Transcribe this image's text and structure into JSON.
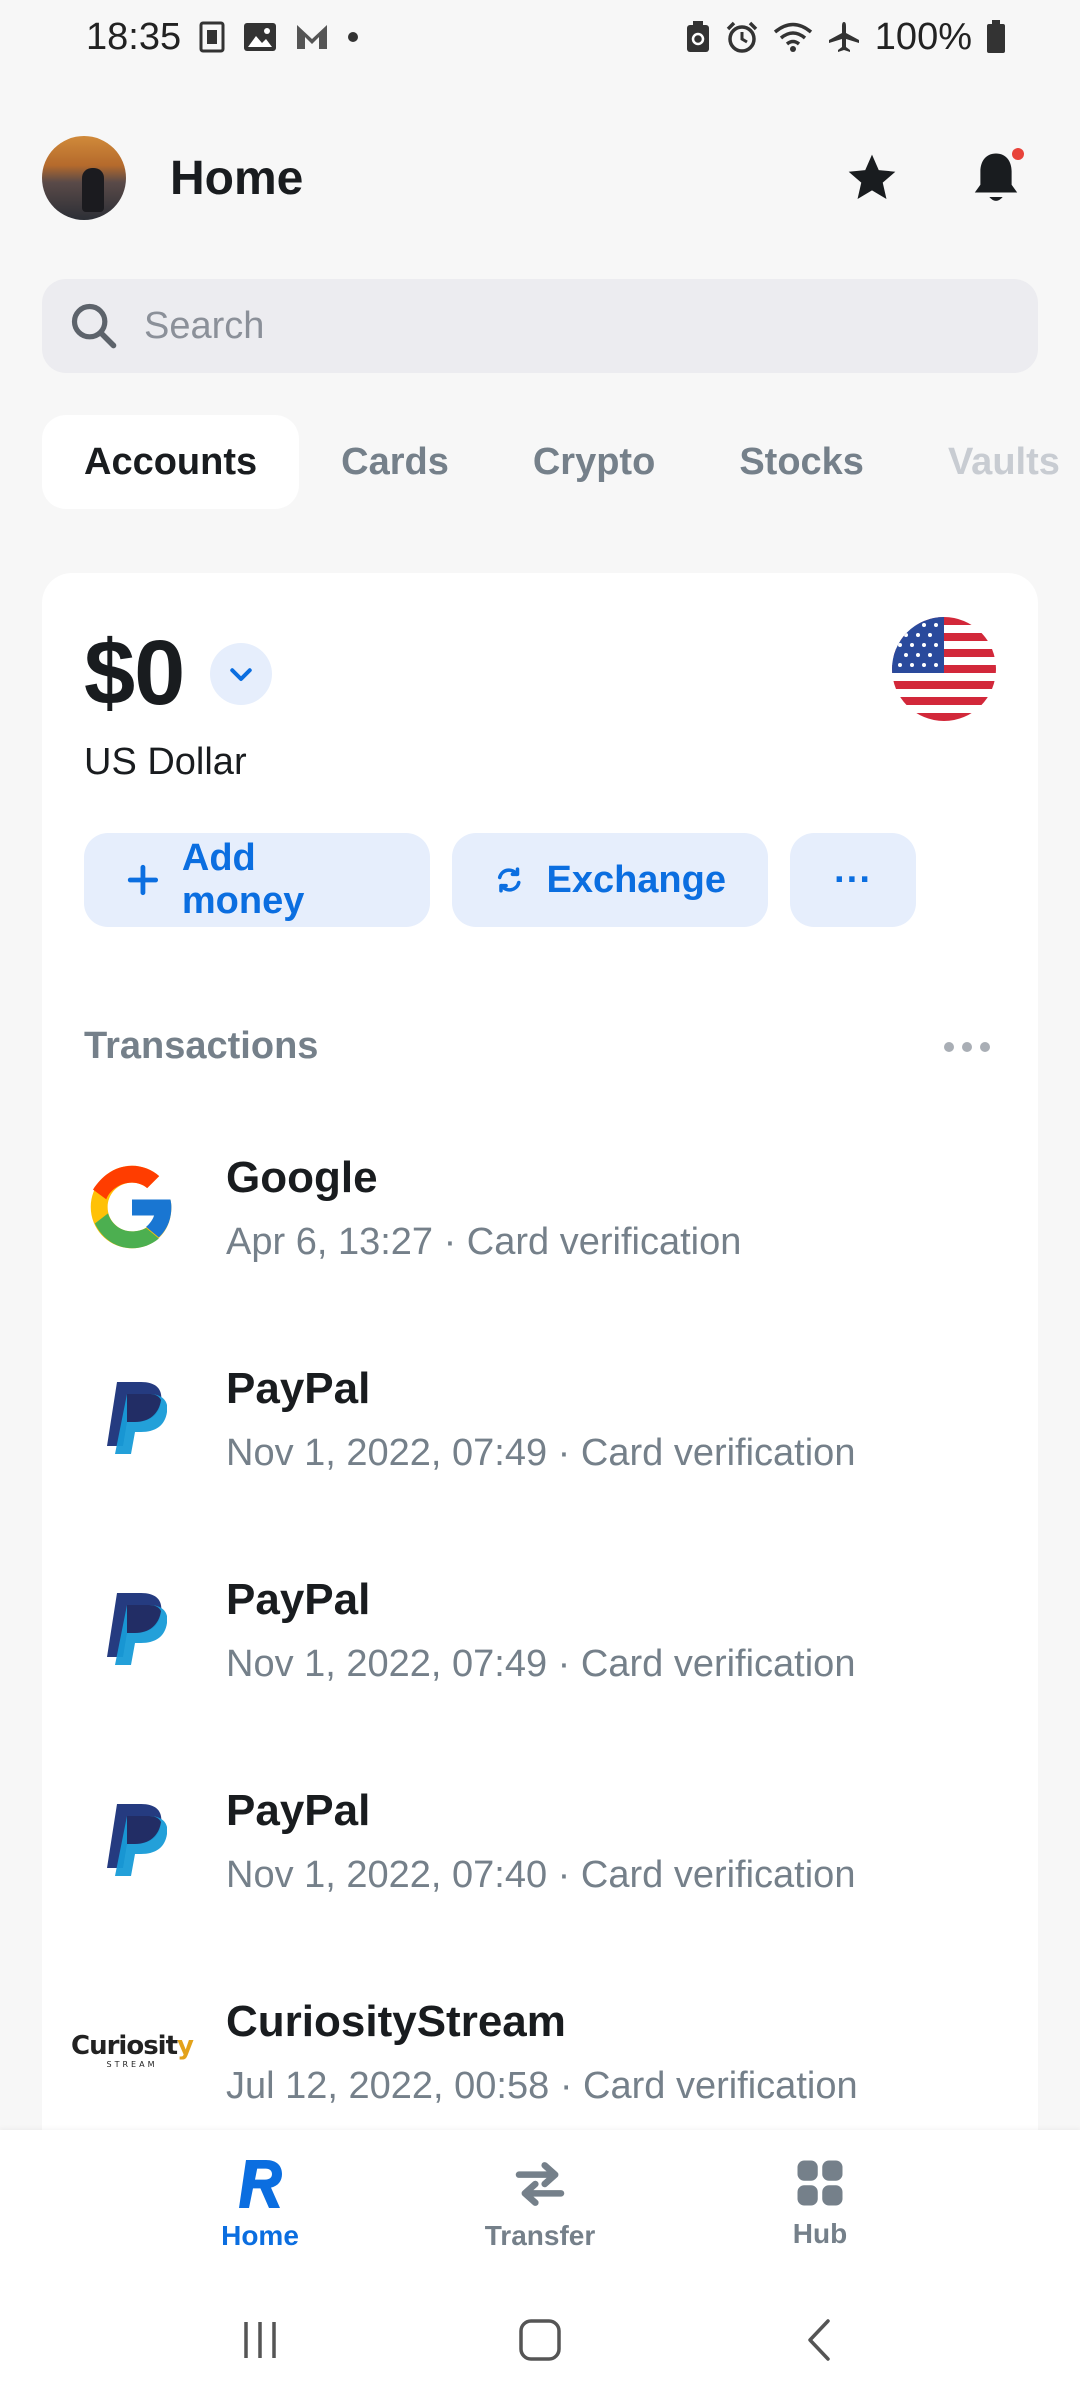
{
  "status_bar": {
    "time": "18:35",
    "battery": "100%"
  },
  "header": {
    "title": "Home"
  },
  "search": {
    "placeholder": "Search"
  },
  "tabs": [
    {
      "label": "Accounts"
    },
    {
      "label": "Cards"
    },
    {
      "label": "Crypto"
    },
    {
      "label": "Stocks"
    },
    {
      "label": "Vaults"
    }
  ],
  "account": {
    "balance": "$0",
    "currency_name": "US Dollar",
    "actions": {
      "add_money": "Add money",
      "exchange": "Exchange",
      "more": "···"
    }
  },
  "transactions": {
    "title": "Transactions",
    "items": [
      {
        "name": "Google",
        "meta": "Apr 6, 13:27 · Card verification",
        "icon": "google-logo"
      },
      {
        "name": "PayPal",
        "meta": "Nov 1, 2022, 07:49 · Card verification",
        "icon": "paypal-logo"
      },
      {
        "name": "PayPal",
        "meta": "Nov 1, 2022, 07:49 · Card verification",
        "icon": "paypal-logo"
      },
      {
        "name": "PayPal",
        "meta": "Nov 1, 2022, 07:40 · Card verification",
        "icon": "paypal-logo"
      },
      {
        "name": "CuriosityStream",
        "meta": "Jul 12, 2022, 00:58 · Card verification",
        "icon": "curiositystream-logo"
      }
    ]
  },
  "curiosity_logo": {
    "main": "Curiosit",
    "y": "y",
    "sub": "STREAM"
  },
  "bottom_nav": [
    {
      "label": "Home",
      "icon": "revolut-r-icon"
    },
    {
      "label": "Transfer",
      "icon": "transfer-arrows-icon"
    },
    {
      "label": "Hub",
      "icon": "hub-grid-icon"
    }
  ],
  "colors": {
    "accent": "#0b6ee0",
    "accent_bg": "#e6eefc",
    "secondary_text": "#75808a",
    "notification_dot": "#e8433a"
  }
}
